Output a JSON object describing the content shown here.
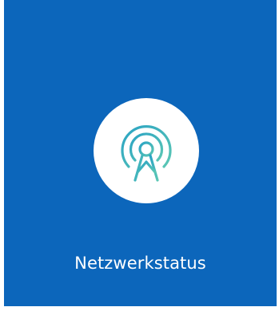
{
  "tile": {
    "label": "Netzwerkstatus",
    "icon": "antenna-broadcast-icon",
    "background_color": "#0c66bb",
    "icon_circle_color": "#ffffff",
    "icon_gradient": [
      "#2aa3c4",
      "#5bc7b4"
    ]
  }
}
